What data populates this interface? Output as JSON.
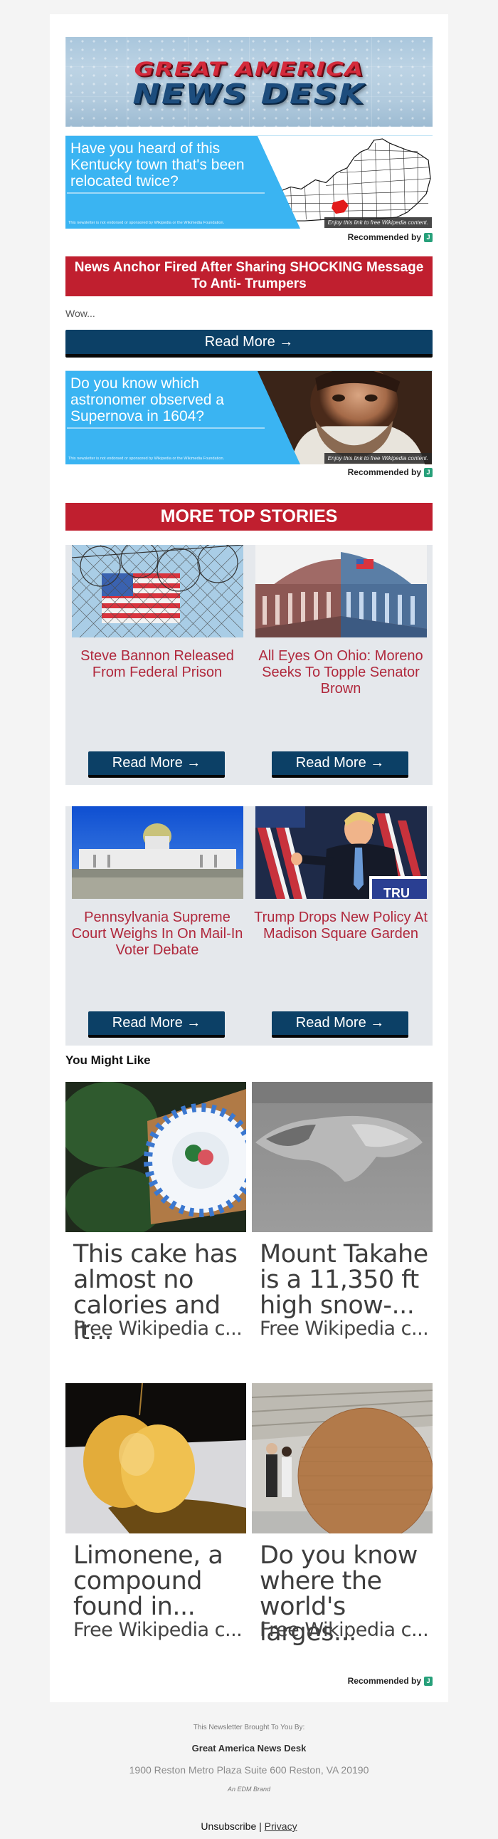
{
  "banner": {
    "line1": "GREAT AMERICA",
    "line2": "NEWS DESK"
  },
  "wiki_ads": [
    {
      "question": "Have you heard of this Kentucky town that's been relocated twice?",
      "disclaimer": "This newsletter is not endorsed or sponsored by Wikipedia or the Wikimedia Foundation.",
      "caption": "Enjoy this link to free Wikipedia content.",
      "image": "kentucky-county-map"
    },
    {
      "question": "Do you know which astronomer observed a Supernova in 1604?",
      "disclaimer": "This newsletter is not endorsed or sponsored by Wikipedia or the Wikimedia Foundation.",
      "caption": "Enjoy this link to free Wikipedia content.",
      "image": "astronomer-portrait"
    }
  ],
  "recommended_by": "Recommended by",
  "recommended_logo": "J",
  "headline": {
    "title": "News Anchor Fired After Sharing SHOCKING Message To Anti- Trumpers",
    "teaser": "Wow...",
    "button": "Read More →"
  },
  "more_top_stories": {
    "title": "MORE TOP STORIES",
    "stories": [
      {
        "title": "Steve Bannon Released From Federal Prison",
        "button": "Read More →",
        "image": "flag-behind-razor-wire"
      },
      {
        "title": "All Eyes On Ohio: Moreno Seeks To Topple Senator Brown",
        "button": "Read More →",
        "image": "capitol-dome-red-blue"
      },
      {
        "title": "Pennsylvania Supreme Court Weighs In On Mail-In Voter Debate",
        "button": "Read More →",
        "image": "pennsylvania-capitol"
      },
      {
        "title": "Trump Drops New Policy At Madison Square Garden",
        "button": "Read More →",
        "image": "trump-thumbs-up"
      }
    ]
  },
  "you_might_like": {
    "title": "You Might Like",
    "tiles": [
      {
        "title": "This cake has almost no calories and it...",
        "source": "Free Wikipedia c...",
        "image": "plate-dessert"
      },
      {
        "title": "Mount Takahe is a 11,350 ft high snow-...",
        "source": "Free Wikipedia c...",
        "image": "mount-takahe-aerial"
      },
      {
        "title": "Limonene, a compound found in...",
        "source": "Free Wikipedia c...",
        "image": "yellow-balloon-popping"
      },
      {
        "title": "Do you know where the world's larges...",
        "source": "Free Wikipedia c...",
        "image": "giant-twine-ball"
      }
    ]
  },
  "footer": {
    "brought_by": "This Newsletter Brought To You By:",
    "brand": "Great America News Desk",
    "address": "1900 Reston Metro Plaza Suite 600 Reston, VA 20190",
    "edm": "An EDM Brand",
    "unsubscribe": "Unsubscribe",
    "separator": "|",
    "privacy": "Privacy"
  },
  "colors": {
    "brand_red": "#c01f2f",
    "button_navy": "#0c4066",
    "story_title_red": "#b0283c",
    "wiki_blue": "#3ab4f2",
    "card_bg": "#e5e8ec",
    "page_bg": "#f4f4f4"
  }
}
